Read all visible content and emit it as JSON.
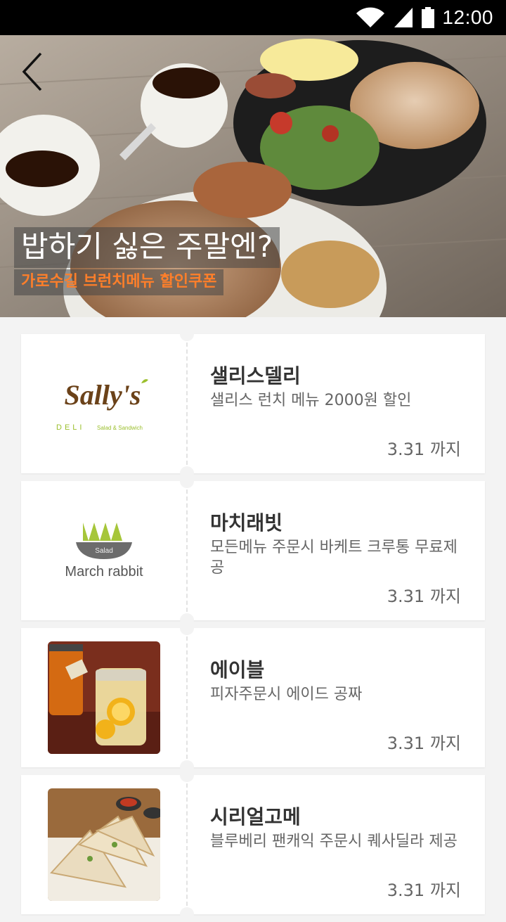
{
  "status_bar": {
    "time": "12:00"
  },
  "hero": {
    "title": "밥하기 싫은 주말엔?",
    "subtitle": "가로수길 브런치메뉴 할인쿠폰"
  },
  "colors": {
    "accent": "#ff7f2a",
    "background": "#f3f3f3"
  },
  "coupons": [
    {
      "name": "샐리스델리",
      "description": "샐리스 런치 메뉴 2000원 할인",
      "expiry": "3.31 까지",
      "logo_title": "Sally's",
      "logo_sub": "DELI",
      "logo_tag": "Salad & Sandwich"
    },
    {
      "name": "마치래빗",
      "description": "모든메뉴 주문시 바케트 크루통 무료제공",
      "expiry": "3.31 까지",
      "logo_bowl": "Salad",
      "logo_title": "March rabbit"
    },
    {
      "name": "에이블",
      "description": "피자주문시 에이드 공짜",
      "expiry": "3.31 까지"
    },
    {
      "name": "시리얼고메",
      "description": "블루베리 팬캐익 주문시 퀘사딜라 제공",
      "expiry": "3.31 까지"
    }
  ]
}
